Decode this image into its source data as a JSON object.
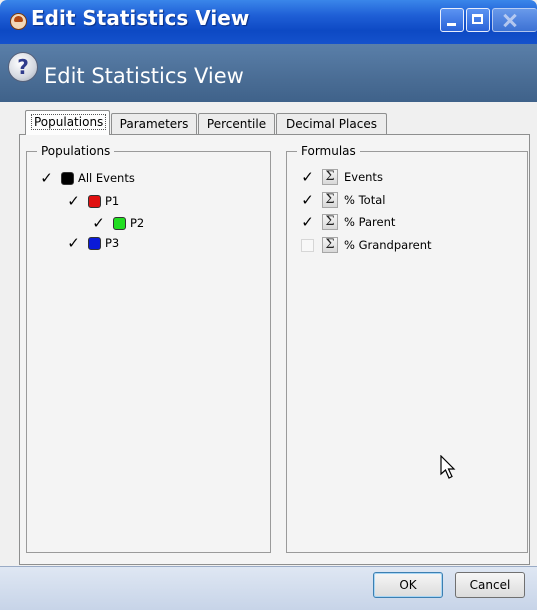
{
  "window": {
    "title": "Edit Statistics View",
    "header_title": "Edit Statistics View"
  },
  "tabs": [
    {
      "label": "Populations",
      "active": true
    },
    {
      "label": "Parameters",
      "active": false
    },
    {
      "label": "Percentile",
      "active": false
    },
    {
      "label": "Decimal Places",
      "active": false
    }
  ],
  "populations": {
    "caption": "Populations",
    "items": [
      {
        "label": "All Events",
        "checked": true,
        "color": "#000000"
      },
      {
        "label": "P1",
        "checked": true,
        "color": "#e01010"
      },
      {
        "label": "P2",
        "checked": true,
        "color": "#22dd22"
      },
      {
        "label": "P3",
        "checked": true,
        "color": "#0a1ad8"
      }
    ]
  },
  "formulas": {
    "caption": "Formulas",
    "items": [
      {
        "label": "Events",
        "checked": true,
        "icon": "sigma-icon"
      },
      {
        "label": "% Total",
        "checked": true,
        "icon": "sigma-icon"
      },
      {
        "label": "% Parent",
        "checked": true,
        "icon": "sigma-icon"
      },
      {
        "label": "% Grandparent",
        "checked": false,
        "icon": "sigma-icon"
      }
    ]
  },
  "buttons": {
    "ok": "OK",
    "cancel": "Cancel"
  },
  "glyphs": {
    "check": "✓",
    "sigma": "Σ",
    "help": "?"
  }
}
